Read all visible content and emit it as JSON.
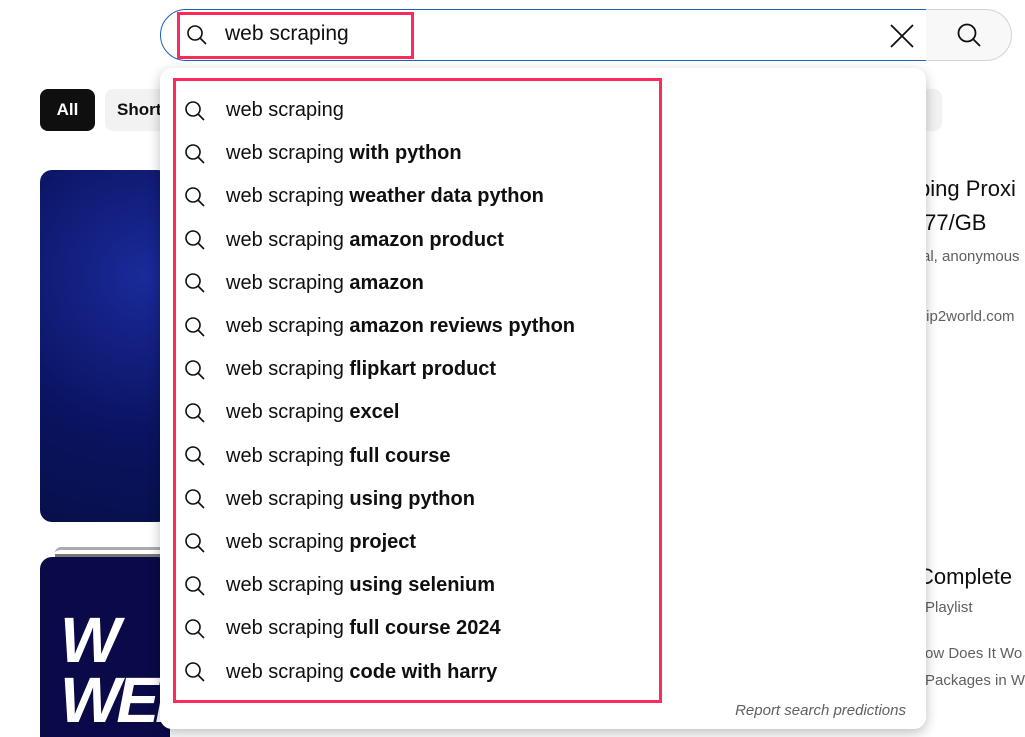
{
  "search": {
    "query": "web scraping",
    "clear_icon": "close-icon",
    "search_icon": "search-icon"
  },
  "chips": [
    {
      "label": "All",
      "selected": true
    },
    {
      "label": "Shorts",
      "selected": false
    }
  ],
  "suggestions": [
    {
      "prefix": "web scraping",
      "suffix": ""
    },
    {
      "prefix": "web scraping",
      "suffix": " with python"
    },
    {
      "prefix": "web scraping",
      "suffix": " weather data python"
    },
    {
      "prefix": "web scraping",
      "suffix": " amazon product"
    },
    {
      "prefix": "web scraping",
      "suffix": " amazon"
    },
    {
      "prefix": "web scraping",
      "suffix": " amazon reviews python"
    },
    {
      "prefix": "web scraping",
      "suffix": " flipkart product"
    },
    {
      "prefix": "web scraping",
      "suffix": " excel"
    },
    {
      "prefix": "web scraping",
      "suffix": " full course"
    },
    {
      "prefix": "web scraping",
      "suffix": " using python"
    },
    {
      "prefix": "web scraping",
      "suffix": " project"
    },
    {
      "prefix": "web scraping",
      "suffix": " using selenium"
    },
    {
      "prefix": "web scraping",
      "suffix": " full course 2024"
    },
    {
      "prefix": "web scraping",
      "suffix": " code with harry"
    }
  ],
  "report_label": "Report search predictions",
  "results": {
    "ad": {
      "title_line1": "ping Proxi",
      "title_line2": ".77/GB",
      "desc": "al, anonymous",
      "domain": ".ip2world.com"
    },
    "playlist": {
      "title": "Complete",
      "type": "Playlist",
      "line1": "ow Does It Wo",
      "line2": "Packages in W"
    },
    "thumb_text": "W\nWEB"
  },
  "colors": {
    "highlight": "#ff2a5c",
    "focus_border": "#1c62b9"
  }
}
